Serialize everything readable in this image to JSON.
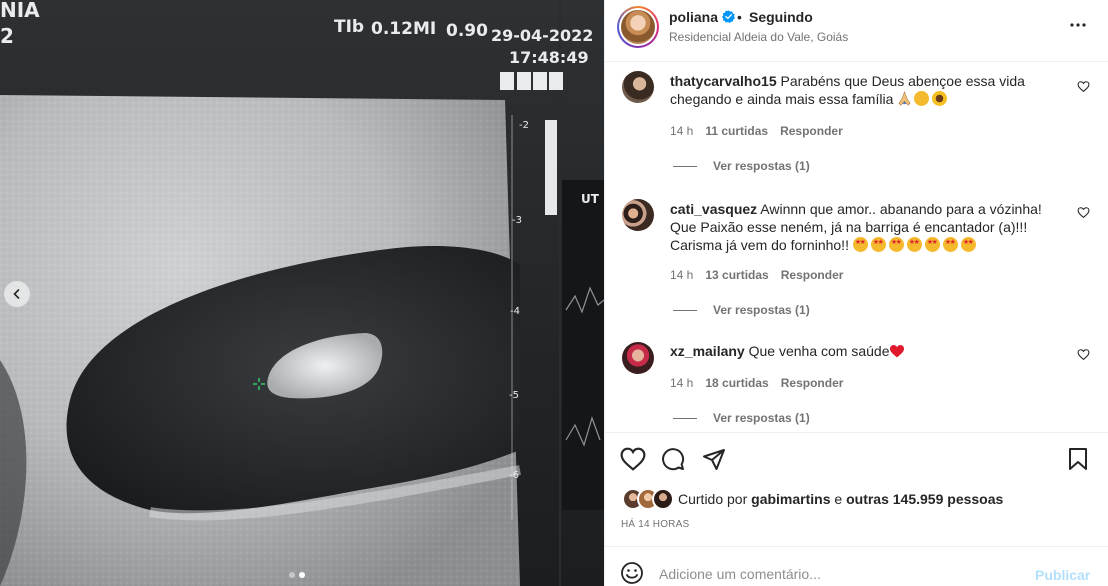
{
  "photo": {
    "overlay": {
      "top_left_1": "NIA",
      "top_left_2": "2",
      "tib_label": "TIb",
      "tib_value": "0.12",
      "mi_label": "MI",
      "mi_value": "0.90",
      "date": "29-04-2022",
      "time": "17:48:49",
      "right_panel_label": "UT D",
      "depth_ticks": [
        "-2",
        "-3",
        "-4",
        "-5",
        "-6"
      ]
    },
    "carousel": {
      "total": 2,
      "active_index": 1
    }
  },
  "post": {
    "author": "poliana",
    "follow_separator": "•",
    "follow_status": "Seguindo",
    "location": "Residencial Aldeia do Vale, Goiás",
    "comments": [
      {
        "user": "thatycarvalho15",
        "text": "Parabéns que Deus abençoe essa vida chegando e ainda mais essa família",
        "emojis": [
          "pray-icon",
          "smile-emoji",
          "sunflower-emoji"
        ],
        "time": "14 h",
        "likes": "11 curtidas",
        "reply_label": "Responder",
        "view_replies": "Ver respostas (1)"
      },
      {
        "user": "cati_vasquez",
        "text": "Awinnn que amor.. abanando para a vózinha! Que Paixão esse neném, já na barriga é encantador (a)!!! Carisma já vem do forninho!!",
        "emojis": [
          "star-struck",
          "star-struck",
          "star-struck",
          "star-struck",
          "star-struck",
          "star-struck",
          "star-struck"
        ],
        "time": "14 h",
        "likes": "13 curtidas",
        "reply_label": "Responder",
        "view_replies": "Ver respostas (1)"
      },
      {
        "user": "xz_mailany",
        "text": "Que venha com saúde",
        "emojis": [
          "red-heart"
        ],
        "time": "14 h",
        "likes": "18 curtidas",
        "reply_label": "Responder",
        "view_replies": "Ver respostas (1)"
      }
    ],
    "liked_by_prefix": "Curtido por",
    "liked_by_user": "gabimartins",
    "liked_by_and": "e",
    "liked_by_others": "outras 145.959 pessoas",
    "time_ago": "HÁ 14 HORAS",
    "comment_placeholder": "Adicione um comentário...",
    "publish_label": "Publicar"
  },
  "colors": {
    "verified": "#0095f6",
    "publish_disabled": "#b2dffc",
    "muted_text": "#737373"
  }
}
